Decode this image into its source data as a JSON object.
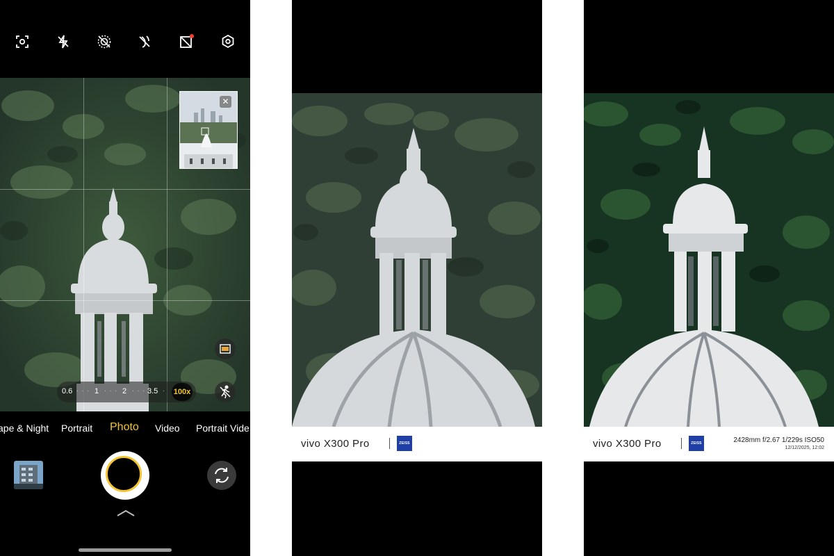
{
  "camera": {
    "top_icons": [
      "focus-icon",
      "flash-off-icon",
      "live-photo-off-icon",
      "motion-off-icon",
      "aspect-ratio-icon",
      "settings-icon"
    ],
    "zoom": {
      "stops": [
        "0.6",
        "1",
        "2",
        "3.5"
      ],
      "active": "100x"
    },
    "modes": [
      "ape & Night",
      "Portrait",
      "Photo",
      "Video",
      "Portrait Vide"
    ],
    "active_mode": "Photo",
    "minimap_close": "✕",
    "colors": {
      "accent": "#f4c430"
    }
  },
  "watermark_a": {
    "brand": "vivo X300 Pro",
    "zeiss": "ZEISS"
  },
  "watermark_b": {
    "brand": "vivo X300 Pro",
    "zeiss": "ZEISS",
    "exif": "2428mm  f/2.67  1/229s  ISO50",
    "datetime": "12/12/2025, 12:02"
  }
}
